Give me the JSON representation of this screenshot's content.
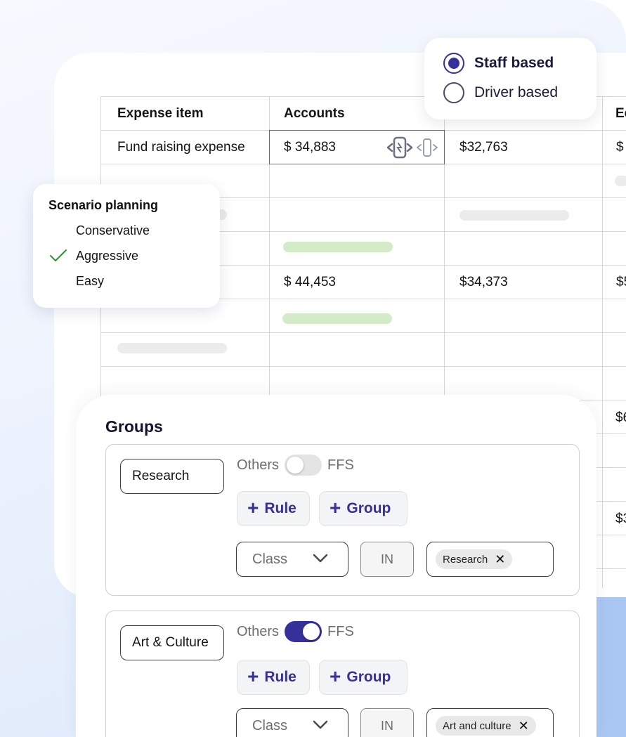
{
  "staff_popover": {
    "option1": "Staff based",
    "option2": "Driver based",
    "selected": "Staff based"
  },
  "table": {
    "headers": [
      "Expense item",
      "Accounts",
      "Ec"
    ],
    "row1": [
      "Fund raising expense",
      "$ 34,883",
      "$32,763",
      "$"
    ],
    "row5": [
      "$ 44,453",
      "$34,373",
      "$5"
    ],
    "partial_col": [
      "$6",
      "$3"
    ]
  },
  "scenario": {
    "title": "Scenario planning",
    "options": [
      "Conservative",
      "Aggressive",
      "Easy"
    ],
    "selected": "Aggressive"
  },
  "groups": {
    "title": "Groups",
    "items": [
      {
        "name": "Research",
        "toggle_left": "Others",
        "toggle_right": "FFS",
        "toggle_on": false,
        "rule_label": "Rule",
        "group_label": "Group",
        "select_value": "Class",
        "operator": "IN",
        "tag": "Research"
      },
      {
        "name": "Art & Culture",
        "toggle_left": "Others",
        "toggle_right": "FFS",
        "toggle_on": true,
        "rule_label": "Rule",
        "group_label": "Group",
        "select_value": "Class",
        "operator": "IN",
        "tag": "Art and culture"
      }
    ]
  },
  "colors": {
    "accent": "#35309a",
    "green_pill": "#d3ebc6",
    "grey_pill": "#ececec"
  }
}
